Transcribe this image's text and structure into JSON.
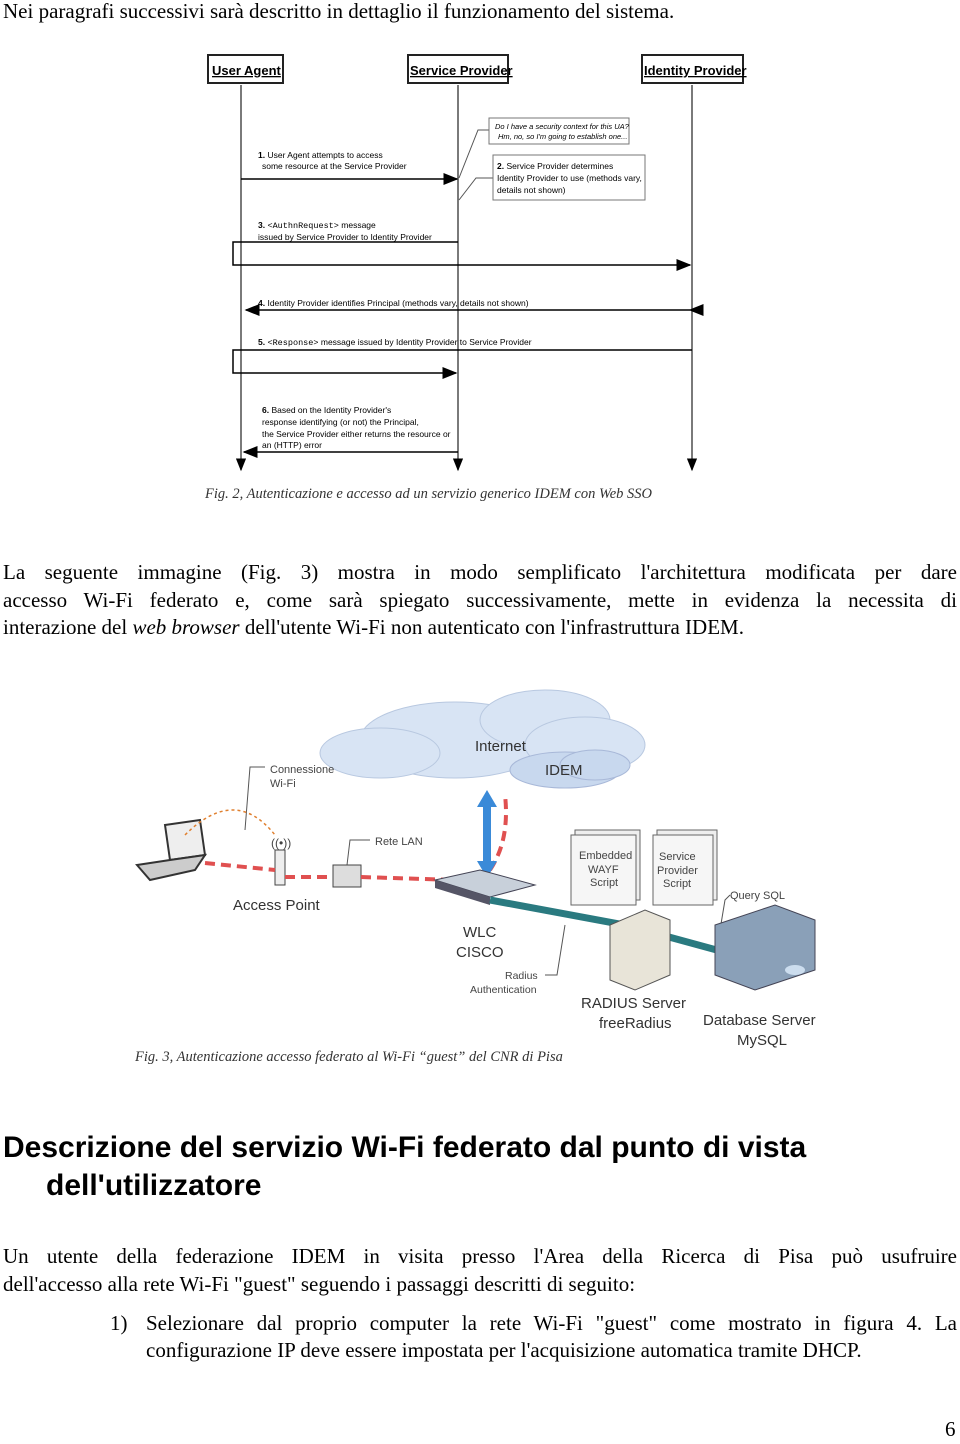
{
  "intro": "Nei paragrafi successivi sarà descritto in dettaglio il funzionamento del sistema.",
  "fig2": {
    "actors": [
      "User Agent",
      "Service Provider",
      "Identity Provider"
    ],
    "note_security": [
      "Do I have a security context for this UA?",
      "Hm, no, so I'm going to establish one..."
    ],
    "step1": {
      "num": "1.",
      "lines": [
        "User Agent attempts to access",
        "some resource at the Service Provider"
      ]
    },
    "step2": {
      "num": "2.",
      "lines": [
        "Service Provider determines",
        "Identity Provider to use (methods vary,",
        "details not shown)"
      ]
    },
    "step3": {
      "num": "3.",
      "code": "<AuthnRequest>",
      "rest": "message",
      "line2": "issued by Service Provider to Identity Provider"
    },
    "step4": {
      "num": "4.",
      "text": "Identity Provider identifies Principal (methods vary, details not shown)"
    },
    "step5": {
      "num": "5.",
      "code": "<Response>",
      "rest": "message issued  by Identity Provider to Service Provider"
    },
    "step6": {
      "num": "6.",
      "lines": [
        "Based on the Identity Provider's",
        "response identifying (or not) the Principal,",
        "the Service Provider either returns the resource or",
        "an (HTTP) error"
      ]
    },
    "caption": "Fig. 2, Autenticazione e accesso ad un servizio generico IDEM con Web SSO"
  },
  "para1": {
    "line1": "La seguente immagine (Fig. 3) mostra in modo semplificato l'architettura modificata per dare",
    "line2": "accesso Wi-Fi federato e, come sarà spiegato successivamente, mette in evidenza la necessita di",
    "line3_a": "interazione del ",
    "line3_em": "web browser",
    "line3_b": " dell'utente Wi-Fi non autenticato con l'infrastruttura IDEM."
  },
  "fig3": {
    "internet": "Internet",
    "idem": "IDEM",
    "wifi_conn": [
      "Connessione",
      "Wi-Fi"
    ],
    "lan": "Rete LAN",
    "access_point": "Access Point",
    "wlc": [
      "WLC",
      "CISCO"
    ],
    "radius_auth": [
      "Radius",
      "Authentication"
    ],
    "wayf": [
      "Embedded",
      "WAYF",
      "Script"
    ],
    "sp_script": [
      "Service",
      "Provider",
      "Script"
    ],
    "query_sql": "Query SQL",
    "radius_server": [
      "RADIUS Server",
      "freeRadius"
    ],
    "db_server": [
      "Database Server",
      "MySQL"
    ],
    "caption": "Fig. 3, Autenticazione accesso federato al Wi-Fi “guest” del CNR di Pisa",
    "colors": {
      "link": "#e05050",
      "arrow": "#3a8ad8",
      "teal": "#2a7a80"
    }
  },
  "heading": [
    "Descrizione del servizio Wi-Fi federato dal punto di vista",
    "dell'utilizzatore"
  ],
  "para2": {
    "line1": "Un utente della federazione IDEM in visita presso l'Area della Ricerca di Pisa può usufruire",
    "line2": "dell'accesso alla rete Wi-Fi \"guest\" seguendo i passaggi descritti di seguito:"
  },
  "list": [
    {
      "marker": "1)",
      "line1": "Selezionare dal proprio computer la rete Wi-Fi \"guest\" come mostrato in figura 4. La",
      "line2": "configurazione IP deve essere impostata per l'acquisizione automatica tramite DHCP."
    }
  ],
  "page_number": "6"
}
